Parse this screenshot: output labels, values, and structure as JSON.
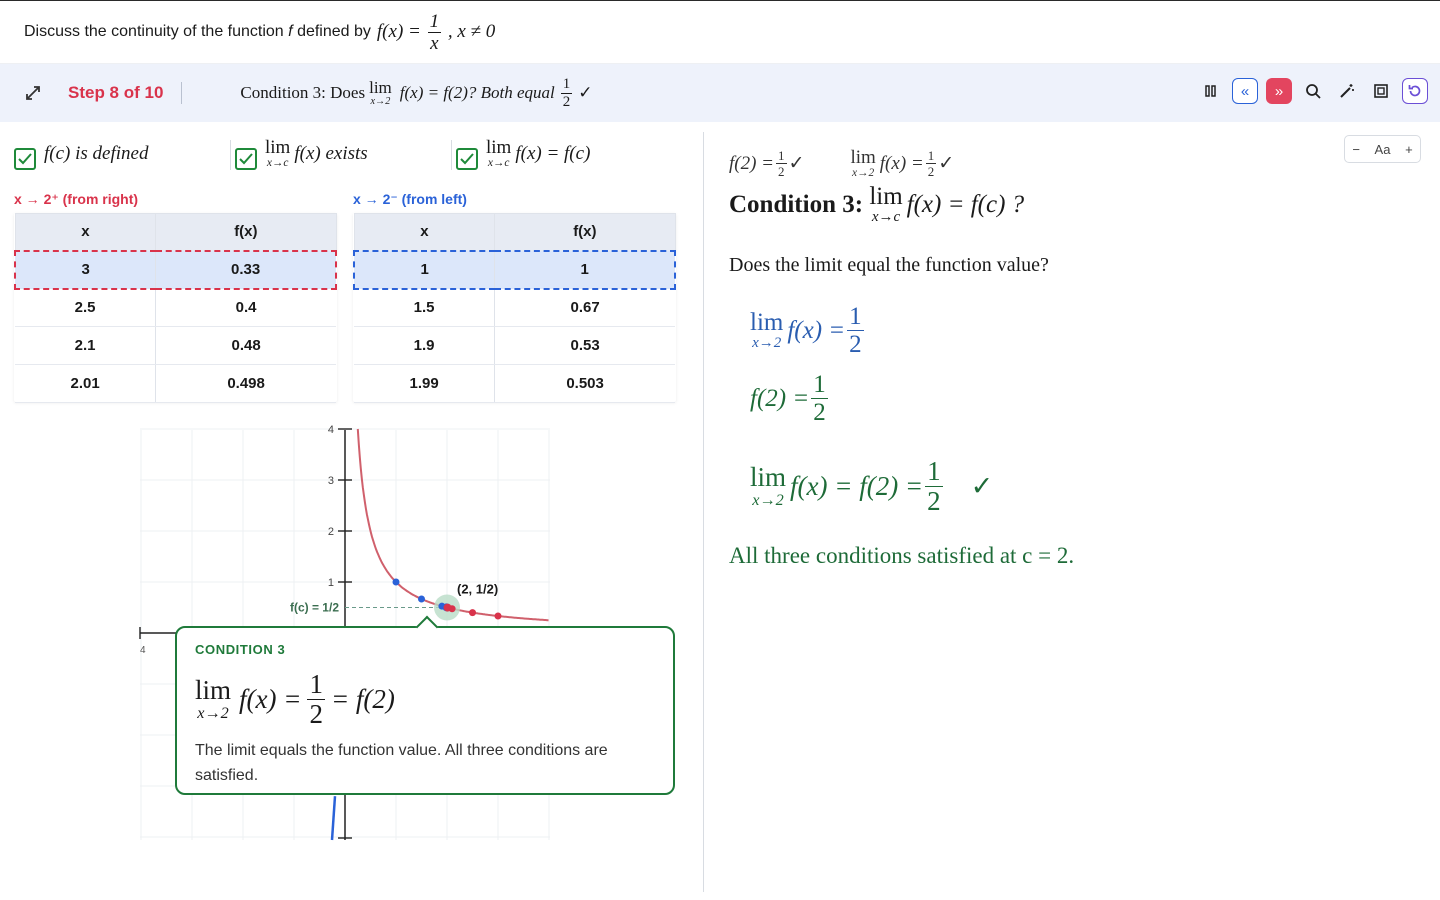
{
  "question": {
    "text": "Discuss the continuity of the function",
    "f": "f",
    "defined_by": "defined by",
    "lhs": "f(x) =",
    "num": "1",
    "den": "x",
    "cond": ", x ≠ 0"
  },
  "step": {
    "label": "Step 8 of 10",
    "desc_prefix": "Condition 3: Does",
    "lim_word": "lim",
    "lim_sub": "x→2",
    "desc_mid": "f(x) = f(2)? Both equal",
    "half_num": "1",
    "half_den": "2",
    "check": "✓"
  },
  "toolbar": {
    "pause": "pause-icon",
    "prev": "«",
    "next": "»",
    "search": "search-icon",
    "wand": "wand-icon",
    "square": "square-icon",
    "reset": "reset-icon"
  },
  "conditions": [
    {
      "text": "f(c) is defined",
      "checked": true
    },
    {
      "lim": "lim",
      "sub": "x→c",
      "text": "f(x) exists",
      "checked": true
    },
    {
      "lim": "lim",
      "sub": "x→c",
      "text": "f(x) = f(c)",
      "checked": true
    }
  ],
  "tables": {
    "right": {
      "label": "x → 2⁺ (from right)",
      "headers": [
        "x",
        "f(x)"
      ],
      "rows": [
        [
          "3",
          "0.33"
        ],
        [
          "2.5",
          "0.4"
        ],
        [
          "2.1",
          "0.48"
        ],
        [
          "2.01",
          "0.498"
        ]
      ]
    },
    "left": {
      "label": "x → 2⁻ (from left)",
      "headers": [
        "x",
        "f(x)"
      ],
      "rows": [
        [
          "1",
          "1"
        ],
        [
          "1.5",
          "0.67"
        ],
        [
          "1.9",
          "0.53"
        ],
        [
          "1.99",
          "0.503"
        ]
      ]
    }
  },
  "graph": {
    "y_ticks": [
      "1",
      "2",
      "3",
      "4"
    ],
    "x_tick_left": "4",
    "fc_label": "f(c) = 1/2",
    "point_label": "(2, 1/2)",
    "colors": {
      "curve": "#d0606c",
      "right_pts": "#d9334b",
      "left_pts": "#2a62d8",
      "guide": "#6a9a8a"
    },
    "right_points": [
      [
        3,
        0.333
      ],
      [
        2.5,
        0.4
      ],
      [
        2.1,
        0.476
      ]
    ],
    "left_points": [
      [
        1,
        1
      ],
      [
        1.5,
        0.667
      ],
      [
        1.9,
        0.526
      ]
    ],
    "target": [
      2,
      0.5
    ]
  },
  "tooltip": {
    "title": "CONDITION 3",
    "lim": "lim",
    "sub": "x→2",
    "lhs": "f(x) =",
    "num": "1",
    "den": "2",
    "rhs": "= f(2)",
    "desc": "The limit equals the function value. All three conditions are satisfied."
  },
  "panel": {
    "font_minus": "−",
    "font_label": "Aa",
    "font_plus": "+",
    "summary_f2": "f(2) =",
    "summary_lim": "lim",
    "summary_sub": "x→2",
    "summary_fx": "f(x) =",
    "half_num": "1",
    "half_den": "2",
    "check": "✓",
    "title_prefix": "Condition 3:",
    "title_lim": "lim",
    "title_sub": "x→c",
    "title_rest": "f(x) = f(c) ?",
    "question": "Does the limit equal the function value?",
    "line1_lim": "lim",
    "line1_sub": "x→2",
    "line1_rest": "f(x) =",
    "line2": "f(2) =",
    "line3_lim": "lim",
    "line3_sub": "x→2",
    "line3_rest": "f(x) = f(2) =",
    "final": "All three conditions satisfied at c = 2."
  }
}
